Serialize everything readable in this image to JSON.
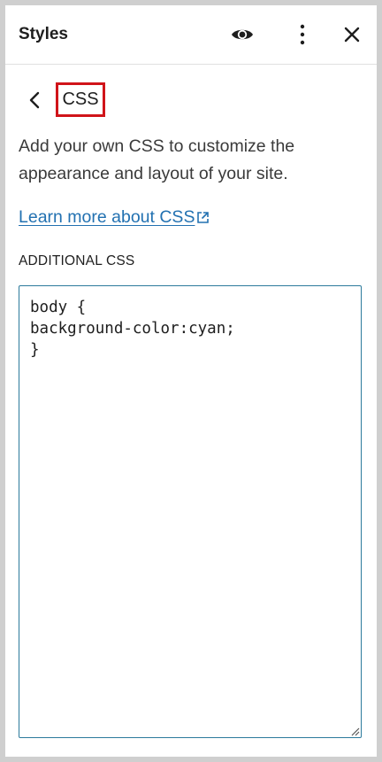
{
  "header": {
    "title": "Styles",
    "icons": [
      "eye-icon",
      "more-vertical-icon",
      "close-icon"
    ]
  },
  "section": {
    "back_icon": "chevron-left-icon",
    "title": "CSS"
  },
  "description": "Add your own CSS to customize the appearance and layout of your site.",
  "learn_more_link": "Learn more about CSS",
  "additional_css": {
    "label": "ADDITIONAL CSS",
    "value": "body {\nbackground-color:cyan;\n}"
  },
  "colors": {
    "link": "#2271b1",
    "editor_border": "#2c7a9c",
    "highlight_box": "#d0141a"
  }
}
